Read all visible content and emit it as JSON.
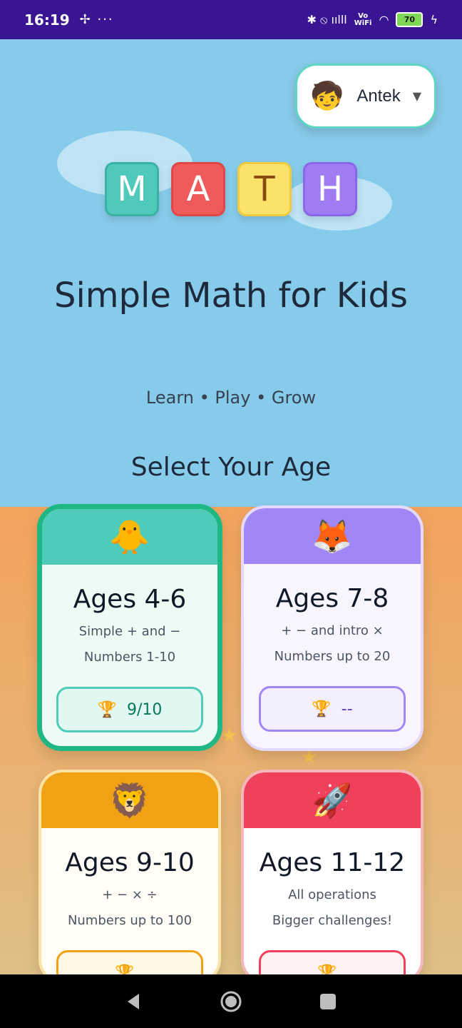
{
  "status_bar": {
    "time": "16:19",
    "left_icons": "✢ ···",
    "right_icons": "✱ ⦸ ıılll",
    "network_line1": "Vo",
    "network_line2": "WiFi",
    "wifi_icon": "◠",
    "battery": "70",
    "charging_icon": "ϟ"
  },
  "profile": {
    "avatar": "🧒",
    "name": "Antek",
    "caret": "▼"
  },
  "logo": {
    "letters": [
      "M",
      "A",
      "T",
      "H"
    ],
    "colors": [
      "#4FC9BA",
      "#EF5A5A",
      "#FBE36B",
      "#9F7CF2"
    ]
  },
  "title": "Simple Math for Kids",
  "tagline": "Learn • Play • Grow",
  "select_label": "Select Your Age",
  "cards": [
    {
      "icon": "🐥",
      "title": "Ages 4-6",
      "line1": "Simple + and −",
      "line2": "Numbers 1-10",
      "score_icon": "🏆",
      "score": "9/10",
      "color": "#4FCCB9",
      "selected": true
    },
    {
      "icon": "🦊",
      "title": "Ages 7-8",
      "line1": "+ − and intro ×",
      "line2": "Numbers up to 20",
      "score_icon": "🏆",
      "score": "--",
      "color": "#A187F5",
      "selected": false
    },
    {
      "icon": "🦁",
      "title": "Ages 9-10",
      "line1": "+ − × ÷",
      "line2": "Numbers up to 100",
      "score_icon": "🏆",
      "score": "",
      "color": "#F1A114",
      "selected": false
    },
    {
      "icon": "🚀",
      "title": "Ages 11-12",
      "line1": "All operations",
      "line2": "Bigger challenges!",
      "score_icon": "🏆",
      "score": "",
      "color": "#F0415C",
      "selected": false
    }
  ]
}
